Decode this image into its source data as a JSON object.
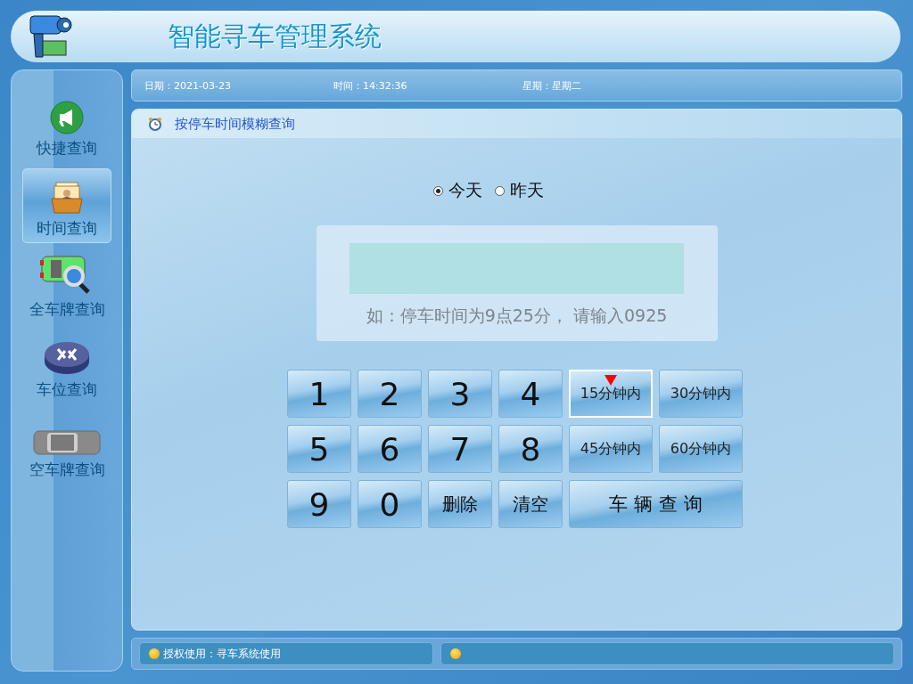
{
  "header": {
    "title": "智能寻车管理系统"
  },
  "sidebar": {
    "items": [
      {
        "label": "快捷查询",
        "selected": false
      },
      {
        "label": "时间查询",
        "selected": true
      },
      {
        "label": "全车牌查询",
        "selected": false
      },
      {
        "label": "车位查询",
        "selected": false
      },
      {
        "label": "空车牌查询",
        "selected": false
      }
    ]
  },
  "info_bar": [
    "日期：2021-03-23",
    "时间：14:32:36",
    "星期：星期二"
  ],
  "panel": {
    "title": "按停车时间模糊查询",
    "day_options": [
      {
        "label": "今天",
        "selected": true
      },
      {
        "label": "昨天",
        "selected": false
      }
    ],
    "hint": "如：停车时间为9点25分， 请输入0925",
    "keys": [
      {
        "label": "1",
        "kind": "digit"
      },
      {
        "label": "2",
        "kind": "digit"
      },
      {
        "label": "3",
        "kind": "digit"
      },
      {
        "label": "4",
        "kind": "digit"
      },
      {
        "label": "15分钟内",
        "kind": "preset",
        "selected": true
      },
      {
        "label": "30分钟内",
        "kind": "preset",
        "selected": false
      },
      {
        "label": "5",
        "kind": "digit"
      },
      {
        "label": "6",
        "kind": "digit"
      },
      {
        "label": "7",
        "kind": "digit"
      },
      {
        "label": "8",
        "kind": "digit"
      },
      {
        "label": "45分钟内",
        "kind": "preset",
        "selected": false
      },
      {
        "label": "60分钟内",
        "kind": "preset",
        "selected": false
      },
      {
        "label": "9",
        "kind": "digit"
      },
      {
        "label": "0",
        "kind": "digit"
      },
      {
        "label": "删除",
        "kind": "action"
      },
      {
        "label": "清空",
        "kind": "action"
      },
      {
        "label": "车 辆 查 询",
        "kind": "search"
      }
    ]
  },
  "status_bar": {
    "license": "授权使用：寻车系统使用"
  }
}
